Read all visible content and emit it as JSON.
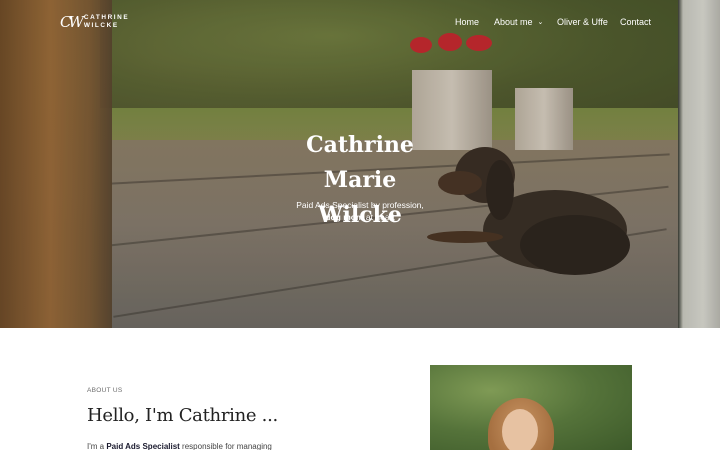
{
  "logo": {
    "mark": "CW",
    "line1": "CATHRINE",
    "line2": "WILCKE"
  },
  "nav": {
    "items": [
      {
        "label": "Home"
      },
      {
        "label": "About me",
        "has_dropdown": true
      },
      {
        "label": "Oliver & Uffe"
      },
      {
        "label": "Contact"
      }
    ]
  },
  "hero": {
    "title_line1": "Cathrine Marie",
    "title_line2": "Wilcke",
    "subtitle_line1": "Paid Ads Specialist by profession,",
    "subtitle_bold": "dog mom",
    "subtitle_rest": " at heart"
  },
  "about": {
    "kicker": "ABOUT US",
    "heading": "Hello, I'm Cathrine ...",
    "body_prefix": "I'm a ",
    "body_bold": "Paid Ads Specialist",
    "body_suffix": " responsible for managing"
  },
  "colors": {
    "text_on_hero": "#ffffff",
    "heading": "#222222",
    "body": "#444444"
  }
}
